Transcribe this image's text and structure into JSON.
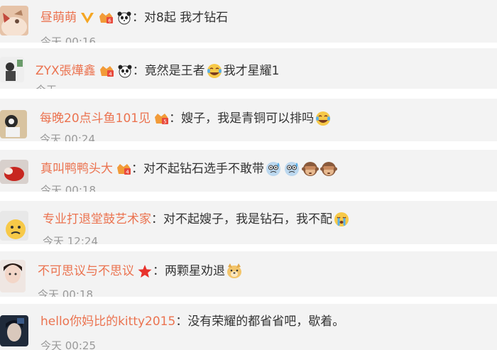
{
  "comments": [
    {
      "username": "昼萌萌",
      "separator": "：",
      "message": "对8起 我才钻石",
      "time": "今天 00:16",
      "badges": [
        "vip-v-icon",
        "crown-level-icon",
        "panda-icon"
      ],
      "emojis": []
    },
    {
      "username": "ZYX張燁鑫",
      "separator": "：",
      "message": "竟然是王者",
      "message_tail": "我才星耀1",
      "time": "今天",
      "badges": [
        "crown-level-icon",
        "panda-icon"
      ],
      "emojis": [
        "laugh-cry-emoji"
      ]
    },
    {
      "username": "每晚20点斗鱼101见",
      "separator": "：",
      "message": "嫂子，我是青铜可以排吗",
      "time": "今天 00:24",
      "badges": [
        "crown-level-icon"
      ],
      "emojis": [
        "laugh-cry-emoji"
      ]
    },
    {
      "username": "真叫鸭鸭头大",
      "separator": "：",
      "message": "对不起钻石选手不敢带",
      "time": "今天 00:18",
      "badges": [
        "crown-level-icon"
      ],
      "emojis": [
        "sweat-emoji",
        "sweat-emoji",
        "see-no-evil-monkey-emoji",
        "see-no-evil-monkey-emoji"
      ]
    },
    {
      "username": "专业打退堂鼓艺术家",
      "separator": "：",
      "message": "对不起嫂子，我是钻石，我不配",
      "time": "今天 12:24",
      "badges": [],
      "emojis": [
        "crying-emoji"
      ]
    },
    {
      "username": "不可思议与不思议",
      "separator": "：",
      "message": "两颗星劝退",
      "time": "今天 00:18",
      "badges": [
        "red-star-icon"
      ],
      "emojis": [
        "doge-emoji"
      ]
    },
    {
      "username": "hello你妈比的kitty2015",
      "separator": "：",
      "message": "没有荣耀的都省省吧，歇着。",
      "time": "今天 00:25",
      "badges": [],
      "emojis": []
    }
  ],
  "colors": {
    "username": "#eb7350",
    "message": "#333333",
    "time": "#999999",
    "row_bg": "#f3f3f3"
  }
}
